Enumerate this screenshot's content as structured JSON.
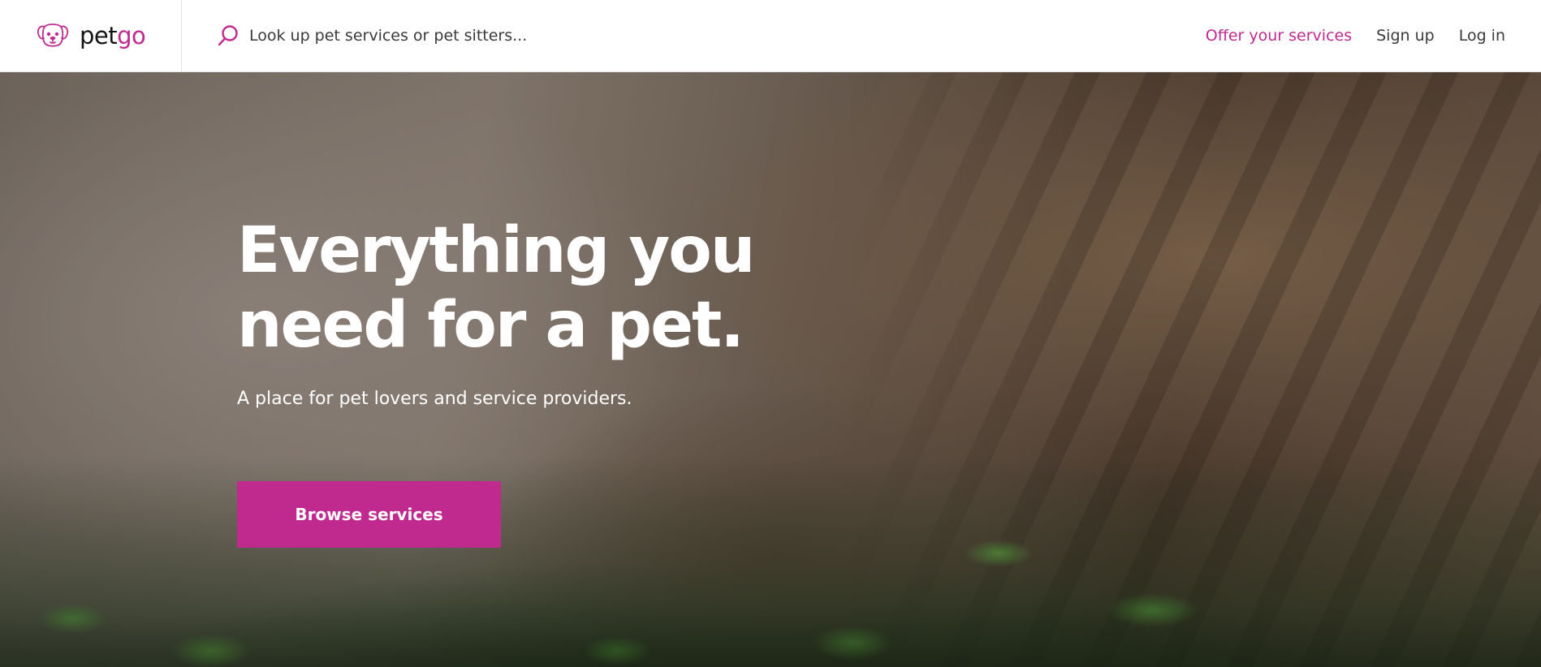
{
  "brand": {
    "name_part1": "pet",
    "name_part2": "go",
    "logo_icon": "dog-face-icon",
    "accent_color": "#c02a8f"
  },
  "search": {
    "icon": "search-icon",
    "placeholder": "Look up pet services or pet sitters..."
  },
  "nav": {
    "offer_label": "Offer your services",
    "signup_label": "Sign up",
    "login_label": "Log in"
  },
  "hero": {
    "title_line1": "Everything you",
    "title_line2": "need for a pet.",
    "subtitle": "A place for pet lovers and service providers.",
    "cta_label": "Browse services"
  }
}
